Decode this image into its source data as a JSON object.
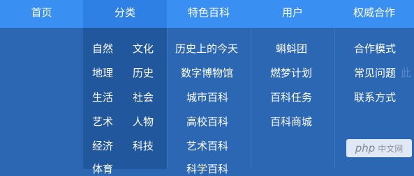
{
  "nav": {
    "home": "首页",
    "category": "分类",
    "featured": "特色百科",
    "user": "用户",
    "authority": "权威合作"
  },
  "category": {
    "left": [
      "自然",
      "地理",
      "生活",
      "艺术",
      "经济",
      "体育"
    ],
    "right": [
      "文化",
      "历史",
      "社会",
      "人物",
      "科技"
    ]
  },
  "featured": [
    "历史上的今天",
    "数字博物馆",
    "城市百科",
    "高校百科",
    "艺术百科",
    "科学百科"
  ],
  "user": [
    "蝌蚪团",
    "燃梦计划",
    "百科任务",
    "百科商城"
  ],
  "authority": [
    "合作模式",
    "常见问题",
    "联系方式"
  ],
  "ghost_text": "此",
  "watermark": {
    "text": "php",
    "sub": "中文网"
  }
}
